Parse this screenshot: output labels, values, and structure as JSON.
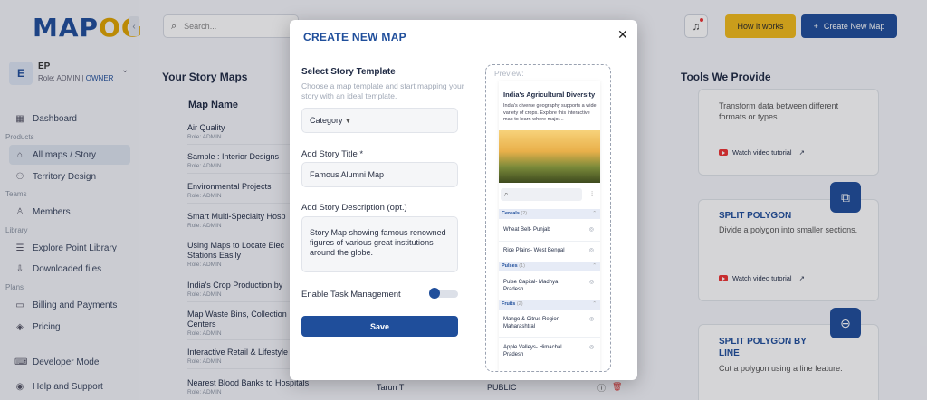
{
  "app": {
    "logo_text_a": "MAP",
    "logo_text_b": "OG"
  },
  "user": {
    "initial": "E",
    "name": "EP",
    "role_prefix": "Role: ADMIN | ",
    "role_owner": "OWNER"
  },
  "sidebar": {
    "sections": [
      "Products",
      "Teams",
      "Library",
      "Plans"
    ],
    "items": [
      {
        "label": "Dashboard"
      },
      {
        "label": "All maps / Story"
      },
      {
        "label": "Territory Design"
      },
      {
        "label": "Members"
      },
      {
        "label": "Explore Point Library"
      },
      {
        "label": "Downloaded files"
      },
      {
        "label": "Billing and Payments"
      },
      {
        "label": "Pricing"
      },
      {
        "label": "Developer Mode"
      },
      {
        "label": "Help and Support"
      }
    ]
  },
  "header": {
    "search_placeholder": "Search...",
    "how_label": "How it works",
    "create_label": "Create New Map"
  },
  "main": {
    "title": "Your Story Maps",
    "col_map_name": "Map Name",
    "rows": [
      {
        "name": "Air Quality",
        "role": "Role: ADMIN"
      },
      {
        "name": "Sample : Interior Designs",
        "role": "Role: ADMIN"
      },
      {
        "name": "Environmental Projects",
        "role": "Role: ADMIN"
      },
      {
        "name": "Smart Multi-Specialty Hosp",
        "role": "Role: ADMIN"
      },
      {
        "name": "Using Maps to Locate Elec Stations Easily",
        "role": "Role: ADMIN"
      },
      {
        "name": "India's Crop Production by",
        "role": "Role: ADMIN"
      },
      {
        "name": "Map Waste Bins, Collection Centers",
        "role": "Role: ADMIN"
      },
      {
        "name": "Interactive Retail & Lifestyle",
        "role": "Role: ADMIN"
      },
      {
        "name": "Nearest Blood Banks to Hospitals",
        "role": "Role: ADMIN"
      }
    ],
    "last_row_owner": "Tarun T",
    "last_row_access": "PUBLIC"
  },
  "tools": {
    "title": "Tools We Provide",
    "cards": [
      {
        "title": "",
        "desc": "Transform data between different formats or types.",
        "video": "Watch video tutorial"
      },
      {
        "title": "SPLIT POLYGON",
        "desc": "Divide a polygon into smaller sections.",
        "video": "Watch video tutorial"
      },
      {
        "title": "SPLIT POLYGON BY LINE",
        "desc": "Cut a polygon using a line feature.",
        "video": ""
      }
    ]
  },
  "modal": {
    "title": "CREATE NEW MAP",
    "template_heading": "Select Story Template",
    "template_sub": "Choose a map template and start mapping your story with an ideal template.",
    "category_label": "Category",
    "title_label": "Add Story Title *",
    "title_value": "Famous Alumni Map",
    "desc_label": "Add Story Description (opt.)",
    "desc_value": "Story Map showing famous renowned figures of various great institutions around the globe.",
    "task_label": "Enable Task Management",
    "task_enabled": true,
    "save_label": "Save",
    "preview_label": "Preview:",
    "preview": {
      "title": "India's Agricultural Diversity",
      "desc": "India's diverse geography supports a wide variety of crops. Explore this interactive map to learn where major...",
      "categories": [
        {
          "name": "Cereals",
          "count": "(2)",
          "items": [
            "Wheat Belt- Punjab",
            "Rice Plains- West Bengal"
          ]
        },
        {
          "name": "Pulses",
          "count": "(1)",
          "items": [
            "Pulse Capital- Madhya Pradesh"
          ]
        },
        {
          "name": "Fruits",
          "count": "(2)",
          "items": [
            "Mango & Citrus Region- Maharashtral",
            "Apple Valleys- Himachal Pradesh"
          ]
        }
      ]
    }
  }
}
